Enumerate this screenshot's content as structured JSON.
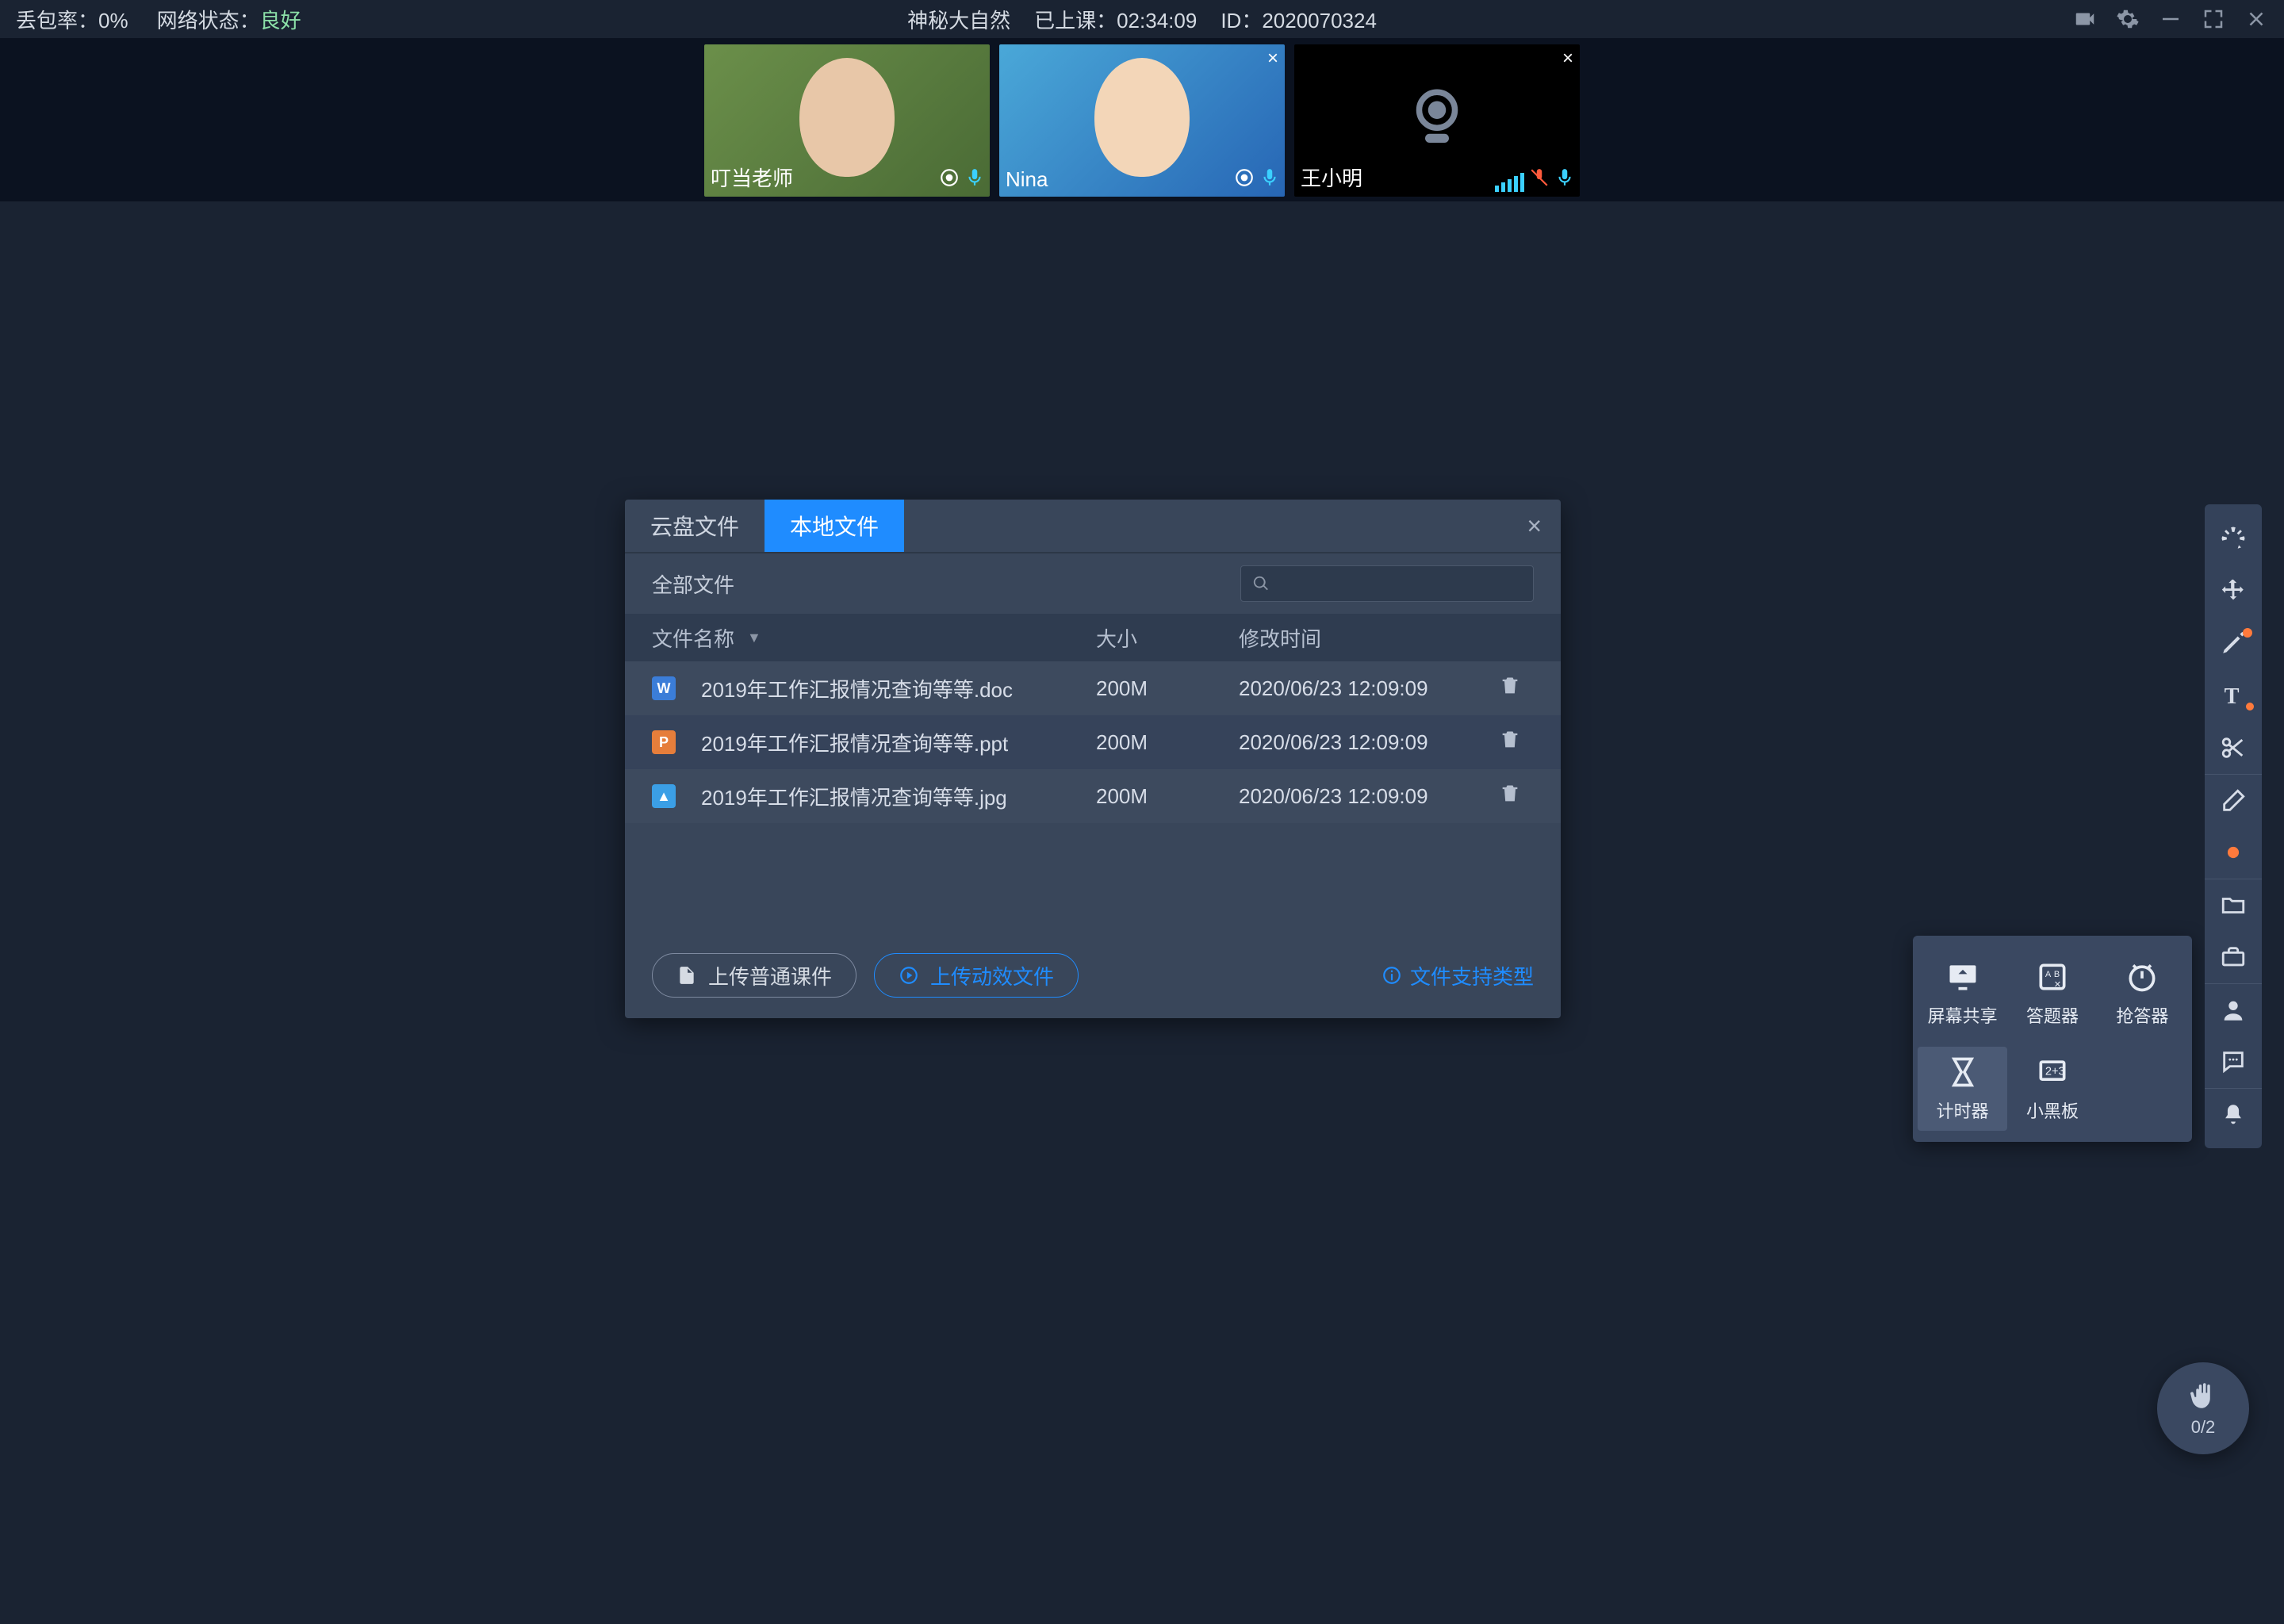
{
  "topbar": {
    "packet_loss_label": "丢包率：",
    "packet_loss_value": "0%",
    "network_label": "网络状态：",
    "network_value": "良好",
    "title": "神秘大自然",
    "session_label": "已上课：",
    "session_time": "02:34:09",
    "id_label": "ID：",
    "id_value": "2020070324"
  },
  "participants": [
    {
      "name": "叮当老师",
      "muted": false,
      "camera": true,
      "closable": false
    },
    {
      "name": "Nina",
      "muted": false,
      "camera": true,
      "closable": true
    },
    {
      "name": "王小明",
      "muted": true,
      "camera": false,
      "closable": true
    }
  ],
  "modal": {
    "tab_cloud": "云盘文件",
    "tab_local": "本地文件",
    "all_files": "全部文件",
    "col_name": "文件名称",
    "col_size": "大小",
    "col_date": "修改时间",
    "files": [
      {
        "icon": "doc",
        "glyph": "W",
        "name": "2019年工作汇报情况查询等等.doc",
        "size": "200M",
        "date": "2020/06/23 12:09:09"
      },
      {
        "icon": "ppt",
        "glyph": "P",
        "name": "2019年工作汇报情况查询等等.ppt",
        "size": "200M",
        "date": "2020/06/23 12:09:09"
      },
      {
        "icon": "img",
        "glyph": "▲",
        "name": "2019年工作汇报情况查询等等.jpg",
        "size": "200M",
        "date": "2020/06/23 12:09:09"
      }
    ],
    "btn_upload_normal": "上传普通课件",
    "btn_upload_anim": "上传动效文件",
    "support_link": "文件支持类型"
  },
  "popover": {
    "screen_share": "屏幕共享",
    "answer": "答题器",
    "buzzer": "抢答器",
    "timer": "计时器",
    "blackboard": "小黑板"
  },
  "hand": {
    "count": "0/2"
  }
}
